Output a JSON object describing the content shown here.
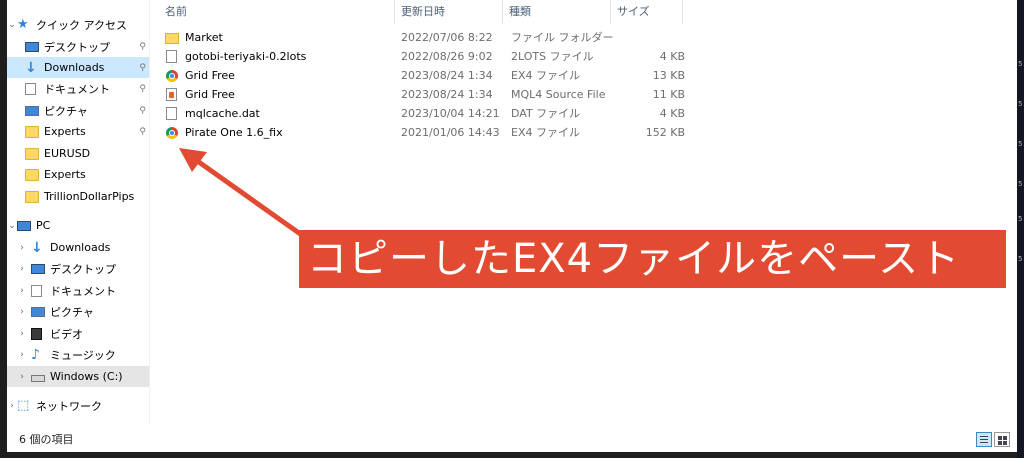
{
  "nav": {
    "quick_access": "クイック アクセス",
    "quick_items": [
      {
        "label": "デスクトップ",
        "icon": "desktop-icon"
      },
      {
        "label": "Downloads",
        "icon": "download-icon"
      },
      {
        "label": "ドキュメント",
        "icon": "document-icon"
      },
      {
        "label": "ピクチャ",
        "icon": "pictures-icon"
      },
      {
        "label": "Experts",
        "icon": "folder-icon"
      },
      {
        "label": "EURUSD",
        "icon": "folder-icon"
      },
      {
        "label": "Experts",
        "icon": "folder-icon"
      },
      {
        "label": "TrillionDollarPips",
        "icon": "folder-icon"
      }
    ],
    "pc": "PC",
    "pc_items": [
      {
        "label": "Downloads",
        "icon": "download-icon"
      },
      {
        "label": "デスクトップ",
        "icon": "desktop-icon"
      },
      {
        "label": "ドキュメント",
        "icon": "document-icon"
      },
      {
        "label": "ピクチャ",
        "icon": "pictures-icon"
      },
      {
        "label": "ビデオ",
        "icon": "video-icon"
      },
      {
        "label": "ミュージック",
        "icon": "music-icon"
      },
      {
        "label": "Windows (C:)",
        "icon": "drive-icon"
      }
    ],
    "network": "ネットワーク"
  },
  "columns": {
    "name": "名前",
    "date": "更新日時",
    "type": "種類",
    "size": "サイズ"
  },
  "files": [
    {
      "name": "Market",
      "date": "2022/07/06 8:22",
      "type": "ファイル フォルダー",
      "size": "",
      "icon": "folder-icon"
    },
    {
      "name": "gotobi-teriyaki-0.2lots",
      "date": "2022/08/26 9:02",
      "type": "2LOTS ファイル",
      "size": "4 KB",
      "icon": "file-icon"
    },
    {
      "name": "Grid Free",
      "date": "2023/08/24 1:34",
      "type": "EX4 ファイル",
      "size": "13 KB",
      "icon": "chrome-icon"
    },
    {
      "name": "Grid Free",
      "date": "2023/08/24 1:34",
      "type": "MQL4 Source File",
      "size": "11 KB",
      "icon": "mql4-file-icon"
    },
    {
      "name": "mqlcache.dat",
      "date": "2023/10/04 14:21",
      "type": "DAT ファイル",
      "size": "4 KB",
      "icon": "file-icon"
    },
    {
      "name": "Pirate One 1.6_fix",
      "date": "2021/01/06 14:43",
      "type": "EX4 ファイル",
      "size": "152 KB",
      "icon": "chrome-icon"
    }
  ],
  "status": {
    "item_count": "6 個の項目"
  },
  "annotation": {
    "text": "コピーしたEX4ファイルをペースト",
    "color": "#e34a32"
  },
  "colors": {
    "selected": "#cce8ff",
    "accent": "#2f86de"
  }
}
